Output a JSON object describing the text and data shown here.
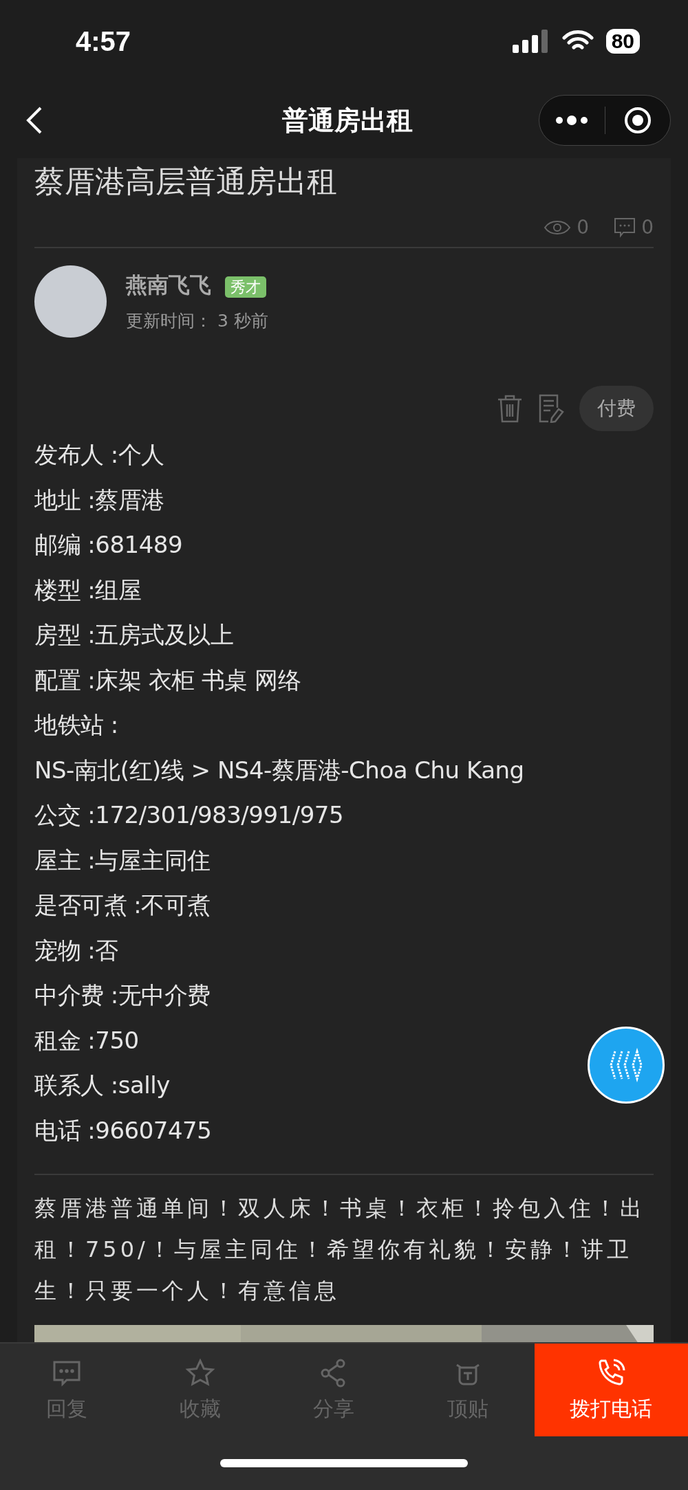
{
  "status_bar": {
    "time": "4:57",
    "battery": "80"
  },
  "nav": {
    "title": "普通房出租"
  },
  "post": {
    "title": "蔡厝港高层普通房出租",
    "views": "0",
    "comments": "0",
    "author": {
      "name": "燕南飞飞",
      "badge": "秀才",
      "updated": "更新时间：  3 秒前"
    },
    "pay_button": "付费",
    "details": [
      "发布人 :个人",
      "地址 :蔡厝港",
      "邮编 :681489",
      "楼型 :组屋",
      "房型 :五房式及以上",
      "配置 :床架 衣柜 书桌 网络",
      "地铁站 :",
      "NS-南北(红)线 > NS4-蔡厝港-Choa Chu Kang",
      "公交 :172/301/983/991/975",
      "屋主 :与屋主同住",
      "是否可煮 :不可煮",
      "宠物 :否",
      "中介费 :无中介费",
      "租金 :750",
      "联系人 :sally",
      "电话 :96607475"
    ],
    "description": "蔡厝港普通单间！双人床！书桌！衣柜！拎包入住！出租！750/！与屋主同住！希望你有礼貌！安静！讲卫生！只要一个人！有意信息"
  },
  "bottom_bar": [
    {
      "kind": "reply",
      "label": "回复"
    },
    {
      "kind": "favorite",
      "label": "收藏"
    },
    {
      "kind": "share",
      "label": "分享"
    },
    {
      "kind": "top",
      "label": "顶贴"
    },
    {
      "kind": "call",
      "label": "拨打电话"
    }
  ]
}
